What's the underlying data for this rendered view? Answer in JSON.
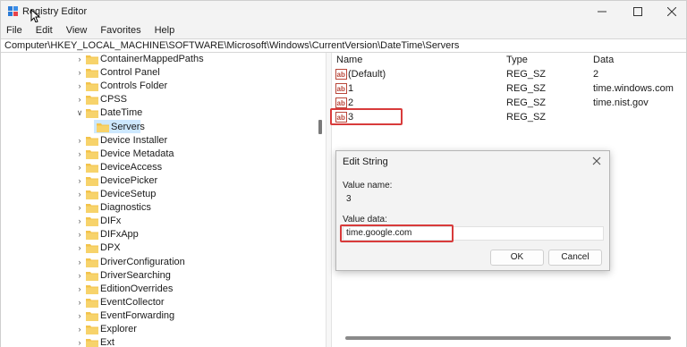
{
  "window": {
    "title": "Registry Editor"
  },
  "menu": [
    "File",
    "Edit",
    "View",
    "Favorites",
    "Help"
  ],
  "address": "Computer\\HKEY_LOCAL_MACHINE\\SOFTWARE\\Microsoft\\Windows\\CurrentVersion\\DateTime\\Servers",
  "tree": [
    {
      "label": "ContainerMappedPaths",
      "expander": "collapsed"
    },
    {
      "label": "Control Panel",
      "expander": "collapsed"
    },
    {
      "label": "Controls Folder",
      "expander": "collapsed"
    },
    {
      "label": "CPSS",
      "expander": "collapsed"
    },
    {
      "label": "DateTime",
      "expander": "expanded"
    },
    {
      "label": "Servers",
      "expander": "none",
      "selected": true
    },
    {
      "label": "Device Installer",
      "expander": "collapsed"
    },
    {
      "label": "Device Metadata",
      "expander": "collapsed"
    },
    {
      "label": "DeviceAccess",
      "expander": "collapsed"
    },
    {
      "label": "DevicePicker",
      "expander": "collapsed"
    },
    {
      "label": "DeviceSetup",
      "expander": "collapsed"
    },
    {
      "label": "Diagnostics",
      "expander": "collapsed"
    },
    {
      "label": "DIFx",
      "expander": "collapsed"
    },
    {
      "label": "DIFxApp",
      "expander": "collapsed"
    },
    {
      "label": "DPX",
      "expander": "collapsed"
    },
    {
      "label": "DriverConfiguration",
      "expander": "collapsed"
    },
    {
      "label": "DriverSearching",
      "expander": "collapsed"
    },
    {
      "label": "EditionOverrides",
      "expander": "collapsed"
    },
    {
      "label": "EventCollector",
      "expander": "collapsed"
    },
    {
      "label": "EventForwarding",
      "expander": "collapsed"
    },
    {
      "label": "Explorer",
      "expander": "collapsed"
    },
    {
      "label": "Ext",
      "expander": "collapsed"
    }
  ],
  "list": {
    "headers": {
      "name": "Name",
      "type": "Type",
      "data": "Data"
    },
    "rows": [
      {
        "name": "(Default)",
        "type": "REG_SZ",
        "data": "2"
      },
      {
        "name": "1",
        "type": "REG_SZ",
        "data": "time.windows.com"
      },
      {
        "name": "2",
        "type": "REG_SZ",
        "data": "time.nist.gov"
      },
      {
        "name": "3",
        "type": "REG_SZ",
        "data": ""
      }
    ]
  },
  "dialog": {
    "title": "Edit String",
    "value_name_label": "Value name:",
    "value_name": "3",
    "value_data_label": "Value data:",
    "value_data": "time.google.com",
    "ok": "OK",
    "cancel": "Cancel"
  },
  "colors": {
    "highlight": "#d83b3b",
    "selection": "#cde8ff",
    "folder": "#f3c34b"
  }
}
